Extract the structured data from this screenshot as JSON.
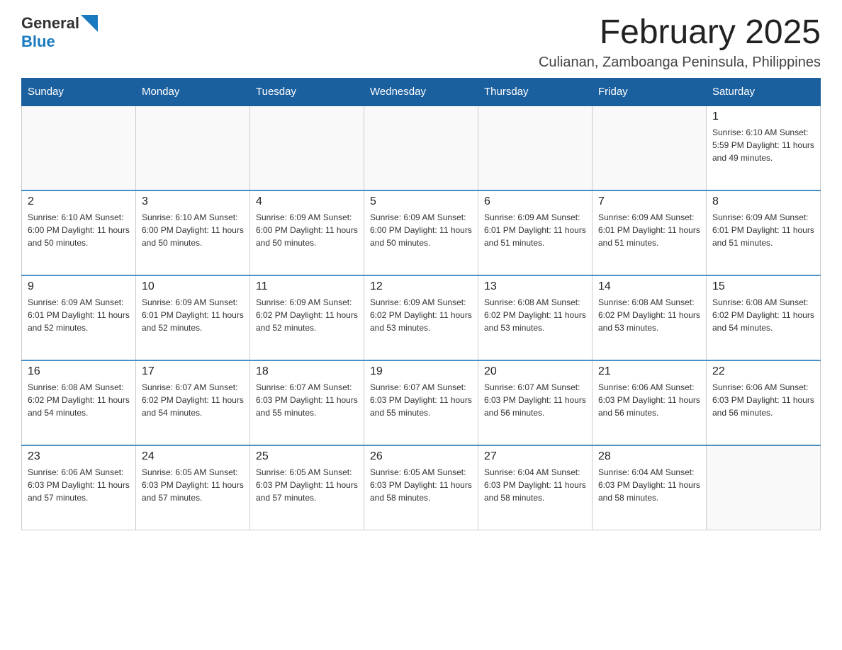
{
  "header": {
    "logo_general": "General",
    "logo_blue": "Blue",
    "month_title": "February 2025",
    "location": "Culianan, Zamboanga Peninsula, Philippines"
  },
  "weekdays": [
    "Sunday",
    "Monday",
    "Tuesday",
    "Wednesday",
    "Thursday",
    "Friday",
    "Saturday"
  ],
  "weeks": [
    [
      {
        "day": "",
        "info": ""
      },
      {
        "day": "",
        "info": ""
      },
      {
        "day": "",
        "info": ""
      },
      {
        "day": "",
        "info": ""
      },
      {
        "day": "",
        "info": ""
      },
      {
        "day": "",
        "info": ""
      },
      {
        "day": "1",
        "info": "Sunrise: 6:10 AM\nSunset: 5:59 PM\nDaylight: 11 hours\nand 49 minutes."
      }
    ],
    [
      {
        "day": "2",
        "info": "Sunrise: 6:10 AM\nSunset: 6:00 PM\nDaylight: 11 hours\nand 50 minutes."
      },
      {
        "day": "3",
        "info": "Sunrise: 6:10 AM\nSunset: 6:00 PM\nDaylight: 11 hours\nand 50 minutes."
      },
      {
        "day": "4",
        "info": "Sunrise: 6:09 AM\nSunset: 6:00 PM\nDaylight: 11 hours\nand 50 minutes."
      },
      {
        "day": "5",
        "info": "Sunrise: 6:09 AM\nSunset: 6:00 PM\nDaylight: 11 hours\nand 50 minutes."
      },
      {
        "day": "6",
        "info": "Sunrise: 6:09 AM\nSunset: 6:01 PM\nDaylight: 11 hours\nand 51 minutes."
      },
      {
        "day": "7",
        "info": "Sunrise: 6:09 AM\nSunset: 6:01 PM\nDaylight: 11 hours\nand 51 minutes."
      },
      {
        "day": "8",
        "info": "Sunrise: 6:09 AM\nSunset: 6:01 PM\nDaylight: 11 hours\nand 51 minutes."
      }
    ],
    [
      {
        "day": "9",
        "info": "Sunrise: 6:09 AM\nSunset: 6:01 PM\nDaylight: 11 hours\nand 52 minutes."
      },
      {
        "day": "10",
        "info": "Sunrise: 6:09 AM\nSunset: 6:01 PM\nDaylight: 11 hours\nand 52 minutes."
      },
      {
        "day": "11",
        "info": "Sunrise: 6:09 AM\nSunset: 6:02 PM\nDaylight: 11 hours\nand 52 minutes."
      },
      {
        "day": "12",
        "info": "Sunrise: 6:09 AM\nSunset: 6:02 PM\nDaylight: 11 hours\nand 53 minutes."
      },
      {
        "day": "13",
        "info": "Sunrise: 6:08 AM\nSunset: 6:02 PM\nDaylight: 11 hours\nand 53 minutes."
      },
      {
        "day": "14",
        "info": "Sunrise: 6:08 AM\nSunset: 6:02 PM\nDaylight: 11 hours\nand 53 minutes."
      },
      {
        "day": "15",
        "info": "Sunrise: 6:08 AM\nSunset: 6:02 PM\nDaylight: 11 hours\nand 54 minutes."
      }
    ],
    [
      {
        "day": "16",
        "info": "Sunrise: 6:08 AM\nSunset: 6:02 PM\nDaylight: 11 hours\nand 54 minutes."
      },
      {
        "day": "17",
        "info": "Sunrise: 6:07 AM\nSunset: 6:02 PM\nDaylight: 11 hours\nand 54 minutes."
      },
      {
        "day": "18",
        "info": "Sunrise: 6:07 AM\nSunset: 6:03 PM\nDaylight: 11 hours\nand 55 minutes."
      },
      {
        "day": "19",
        "info": "Sunrise: 6:07 AM\nSunset: 6:03 PM\nDaylight: 11 hours\nand 55 minutes."
      },
      {
        "day": "20",
        "info": "Sunrise: 6:07 AM\nSunset: 6:03 PM\nDaylight: 11 hours\nand 56 minutes."
      },
      {
        "day": "21",
        "info": "Sunrise: 6:06 AM\nSunset: 6:03 PM\nDaylight: 11 hours\nand 56 minutes."
      },
      {
        "day": "22",
        "info": "Sunrise: 6:06 AM\nSunset: 6:03 PM\nDaylight: 11 hours\nand 56 minutes."
      }
    ],
    [
      {
        "day": "23",
        "info": "Sunrise: 6:06 AM\nSunset: 6:03 PM\nDaylight: 11 hours\nand 57 minutes."
      },
      {
        "day": "24",
        "info": "Sunrise: 6:05 AM\nSunset: 6:03 PM\nDaylight: 11 hours\nand 57 minutes."
      },
      {
        "day": "25",
        "info": "Sunrise: 6:05 AM\nSunset: 6:03 PM\nDaylight: 11 hours\nand 57 minutes."
      },
      {
        "day": "26",
        "info": "Sunrise: 6:05 AM\nSunset: 6:03 PM\nDaylight: 11 hours\nand 58 minutes."
      },
      {
        "day": "27",
        "info": "Sunrise: 6:04 AM\nSunset: 6:03 PM\nDaylight: 11 hours\nand 58 minutes."
      },
      {
        "day": "28",
        "info": "Sunrise: 6:04 AM\nSunset: 6:03 PM\nDaylight: 11 hours\nand 58 minutes."
      },
      {
        "day": "",
        "info": ""
      }
    ]
  ]
}
